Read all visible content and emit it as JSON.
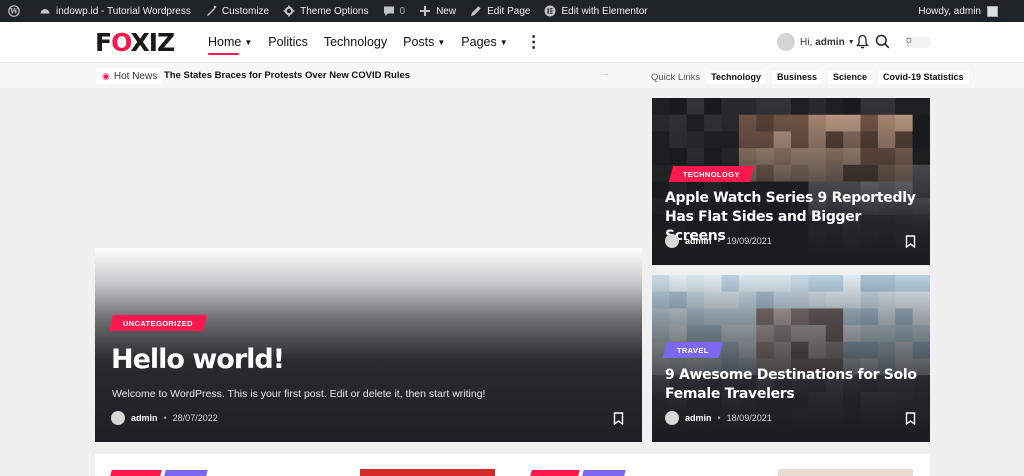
{
  "adminbar": {
    "site_name": "indowp.id - Tutorial Wordpress",
    "customize": "Customize",
    "theme_options": "Theme Options",
    "comments_count": "0",
    "new": "New",
    "edit_page": "Edit Page",
    "edit_elementor": "Edit with Elementor",
    "howdy": "Howdy, admin"
  },
  "header": {
    "logo_f": "F",
    "logo_o": "O",
    "logo_rest": "XIZ",
    "nav": [
      "Home",
      "Politics",
      "Technology",
      "Posts",
      "Pages"
    ],
    "greeting": "Hi,",
    "username": "admin"
  },
  "subbar": {
    "hot_label": "Hot News",
    "ticker": "The States Braces for Protests Over New COVID Rules",
    "quick_title": "Quick Links",
    "quick_links": [
      "Technology",
      "Business",
      "Science",
      "Covid-19 Statistics"
    ]
  },
  "hero": {
    "category": "UNCATEGORIZED",
    "title": "Hello world!",
    "excerpt": "Welcome to WordPress. This is your first post. Edit or delete it, then start writing!",
    "author": "admin",
    "date": "28/07/2022"
  },
  "cards": [
    {
      "category": "TECHNOLOGY",
      "title": "Apple Watch Series 9 Reportedly Has Flat Sides and Bigger Screens",
      "author": "admin",
      "date": "19/09/2021"
    },
    {
      "category": "TRAVEL",
      "title": "9 Awesome Destinations for Solo Female Travelers",
      "author": "admin",
      "date": "18/09/2021"
    }
  ],
  "colors": {
    "accent": "#ff184e",
    "travel": "#7b68ee",
    "adminbar": "#1d2327"
  },
  "icons": [
    "wordpress-icon",
    "palette-icon",
    "gear-icon",
    "comment-icon",
    "plus-icon",
    "pencil-icon",
    "elementor-icon",
    "bell-icon",
    "search-icon",
    "sun-icon",
    "bookmark-icon",
    "flame-icon",
    "arrow-right-icon"
  ]
}
